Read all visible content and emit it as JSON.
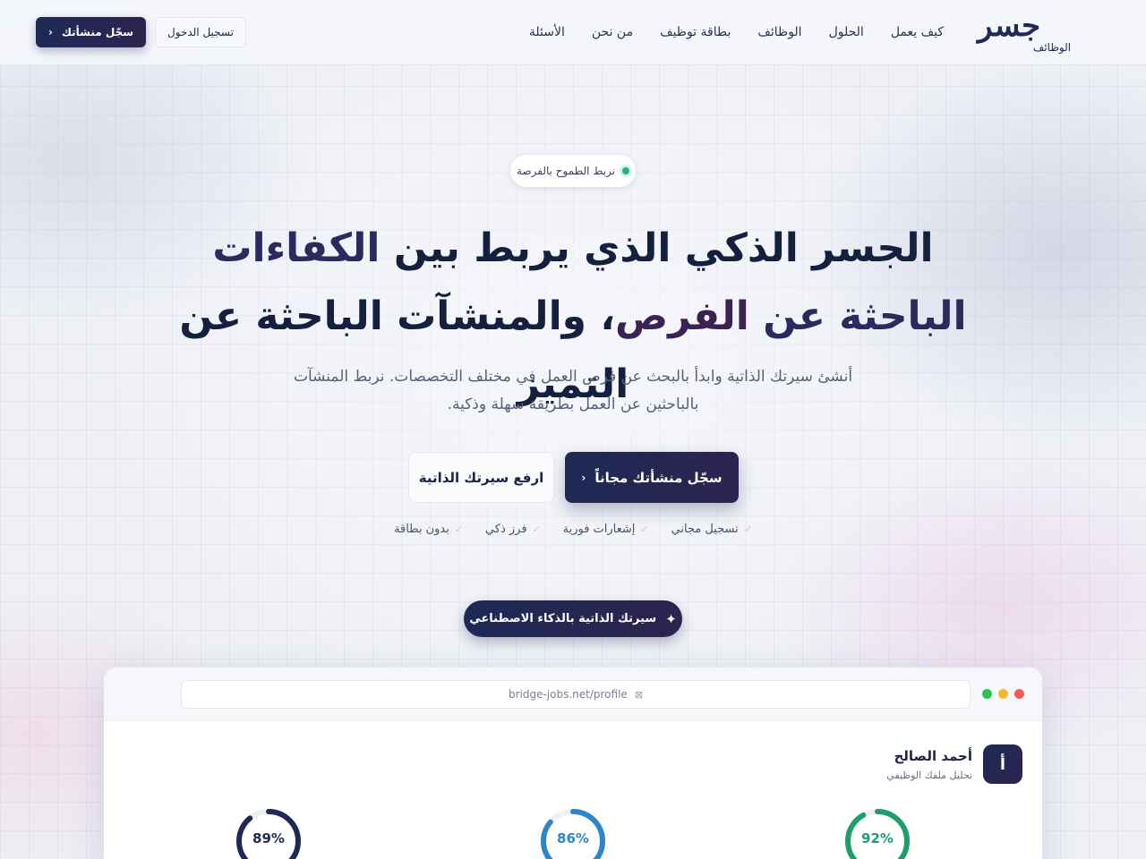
{
  "nav": {
    "logo_main": "جسر",
    "logo_sub": "الوظائف",
    "links": [
      "كيف يعمل",
      "الحلول",
      "الوظائف",
      "بطاقة توظيف",
      "من نحن",
      "الأسئلة"
    ],
    "login_label": "تسجيل الدخول",
    "register_label": "سجّل منشأتك"
  },
  "hero": {
    "pill": "نربط الطموح بالفرصة",
    "headline_part1": "الجسر الذكي الذي يربط بين ",
    "headline_accent": "الكفاءات الباحثة عن",
    "headline_purple": "الفرص",
    "headline_part2": "، والمنشآت الباحثة عن التميز",
    "subtext": "أنشئ سيرتك الذاتية وابدأ بالبحث عن فرص العمل في مختلف التخصصات. نربط المنشآت بالباحثين عن العمل بطريقة سهلة وذكية.",
    "cta_primary": "سجّل منشأتك مجاناً",
    "cta_secondary": "ارفع سيرتك الذاتية",
    "features": [
      "تسجيل مجاني",
      "إشعارات فورية",
      "فرز ذكي",
      "بدون بطاقة"
    ],
    "ai_badge": "سيرتك الذاتية بالذكاء الاصطناعي"
  },
  "mock": {
    "url": "bridge-jobs.net/profile",
    "avatar_letter": "أ",
    "profile_name": "أحمد الصالح",
    "profile_sub": "تحليل ملفك الوظيفي",
    "gauges": [
      {
        "value": 92,
        "label": "92%",
        "color": "#1f9d6b"
      },
      {
        "value": 86,
        "label": "86%",
        "color": "#2e86c9"
      },
      {
        "value": 89,
        "label": "89%",
        "color": "#1d2a55"
      }
    ]
  },
  "colors": {
    "primary": "#1d2a55",
    "accent_purple": "#2e2350",
    "success": "#22b573"
  }
}
